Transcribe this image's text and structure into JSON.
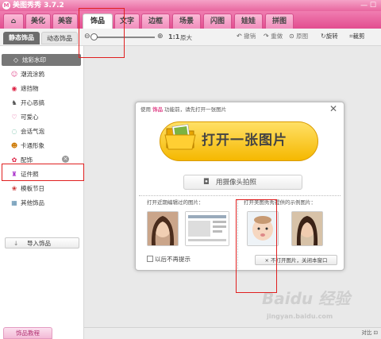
{
  "app": {
    "title": "美图秀秀 3.7.2",
    "logo": "M",
    "window_controls": "— ☐"
  },
  "tabs": [
    {
      "label": "⌂"
    },
    {
      "label": "美化"
    },
    {
      "label": "美容"
    },
    {
      "label": "饰品"
    },
    {
      "label": "文字"
    },
    {
      "label": "边框"
    },
    {
      "label": "场景"
    },
    {
      "label": "闪图"
    },
    {
      "label": "娃娃"
    },
    {
      "label": "拼图"
    }
  ],
  "side_tabs": {
    "active": "静态饰品",
    "inactive": "动态饰品"
  },
  "toolbar": {
    "zoom_out_icon": "⊖",
    "zoom_in_icon": "⊕",
    "ratio": "1:1",
    "enlarge": "原大",
    "undo": "撤销",
    "redo": "重做",
    "original": "原图",
    "rotate": "旋转",
    "crop": "裁剪"
  },
  "categories": [
    {
      "label": "炫彩水印",
      "icon": "◇",
      "selected": true
    },
    {
      "label": "潮流涂鸦",
      "icon": "☺"
    },
    {
      "label": "遮挡物",
      "icon": "◉"
    },
    {
      "label": "开心恶搞",
      "icon": "♞"
    },
    {
      "label": "可爱心",
      "icon": "♡"
    },
    {
      "label": "会话气泡",
      "icon": "◌"
    },
    {
      "label": "卡通形象",
      "icon": "☻"
    },
    {
      "label": "配饰",
      "icon": "✿"
    },
    {
      "label": "证件照",
      "icon": "♜"
    },
    {
      "label": "模板节日",
      "icon": "❀"
    },
    {
      "label": "其他饰品",
      "icon": "▦"
    }
  ],
  "import_button": {
    "icon": "↓",
    "label": "导入饰品"
  },
  "tutorial_button": "饰品教程",
  "dialog": {
    "header_pre": "使用",
    "header_highlight": "饰品",
    "header_post": "功能前，请先打开一张图片",
    "close_icon": "✕",
    "open_label": "打开一张图片",
    "camera_label": "用摄像头拍照",
    "recent_label": "打开近期编辑过的图片：",
    "sample_label": "打开美图秀秀提供的示例图片：",
    "dont_show": "以后不再提示",
    "no_open": "× 不打开图片，关闭本窗口"
  },
  "watermark": {
    "big": "Baidu 经验",
    "small": "jingyan.baidu.com"
  },
  "bottom_icons": "对比 ⊡",
  "colors": {
    "accent": "#e24d8f",
    "tab_bg": "#f08fbd",
    "annotation": "#e02020"
  }
}
